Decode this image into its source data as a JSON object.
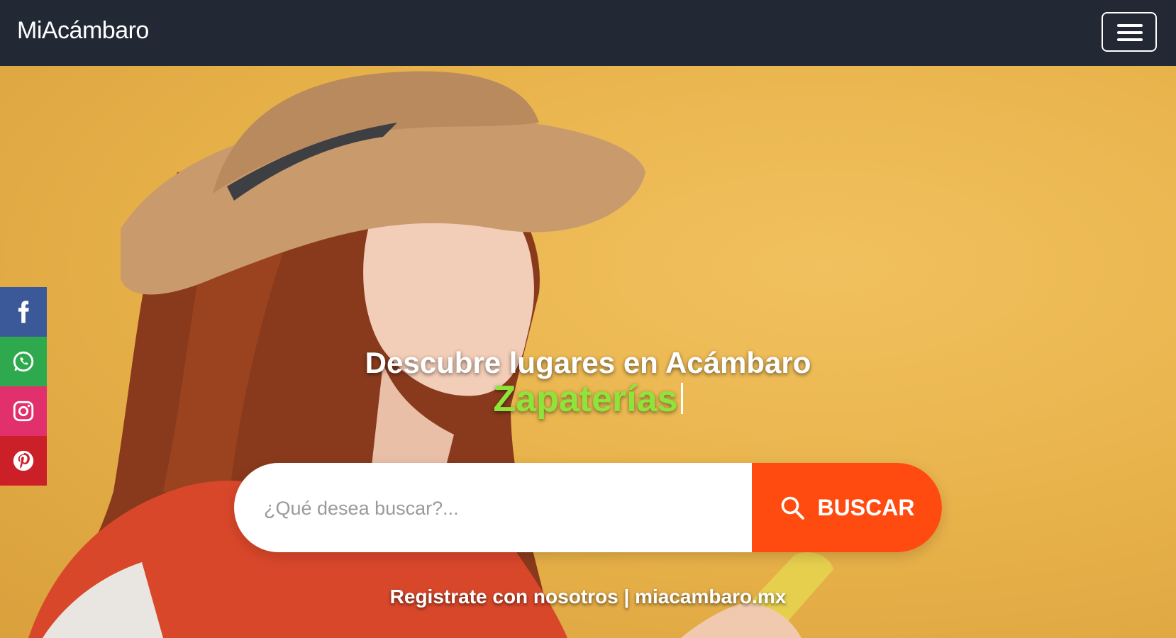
{
  "navbar": {
    "brand": "MiAcámbaro",
    "toggle_icon": "hamburger-menu-icon"
  },
  "social": [
    {
      "name": "facebook",
      "icon": "facebook-icon",
      "color": "#3b5998"
    },
    {
      "name": "whatsapp",
      "icon": "whatsapp-icon",
      "color": "#2fa94d"
    },
    {
      "name": "instagram",
      "icon": "instagram-icon",
      "color": "#e1306c"
    },
    {
      "name": "pinterest",
      "icon": "pinterest-icon",
      "color": "#cb2027"
    }
  ],
  "hero": {
    "headline": "Descubre lugares en Acámbaro",
    "typed_text": "Zapaterías",
    "typed_color": "#8fe43a"
  },
  "search": {
    "placeholder": "¿Qué desea buscar?...",
    "value": "",
    "button_label": "BUSCAR",
    "button_color": "#ff4b0f"
  },
  "footer_link": "Registrate con nosotros | miacambaro.mx"
}
